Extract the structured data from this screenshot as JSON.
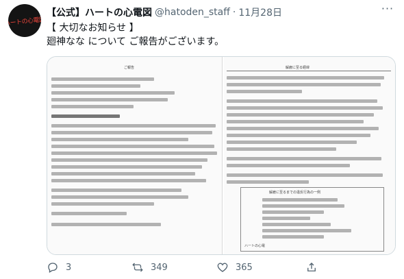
{
  "tweet": {
    "avatar_text": "ハートの心電図",
    "display_name": "【公式】ハートの心電図",
    "handle": "@hatoden_staff",
    "separator": "·",
    "date": "11月28日",
    "more_label": "···",
    "body_lines": [
      "【 大切なお知らせ 】",
      "廻神なな について ご報告がございます。"
    ]
  },
  "media": {
    "left_doc_title": "ご報告",
    "right_doc_title": "解雇に至る経緯",
    "right_box_title": "解雇に至るまでの違反行為の一例",
    "signature": "ハートの心電"
  },
  "actions": {
    "reply_count": "3",
    "retweet_count": "349",
    "like_count": "365"
  },
  "icons": {
    "reply": "reply-icon",
    "retweet": "retweet-icon",
    "like": "heart-icon",
    "share": "share-icon",
    "more": "more-icon"
  },
  "colors": {
    "text_primary": "#0f1419",
    "text_secondary": "#536471",
    "border": "#cfd9de",
    "avatar_bg": "#141414",
    "avatar_text": "#e8443a"
  }
}
